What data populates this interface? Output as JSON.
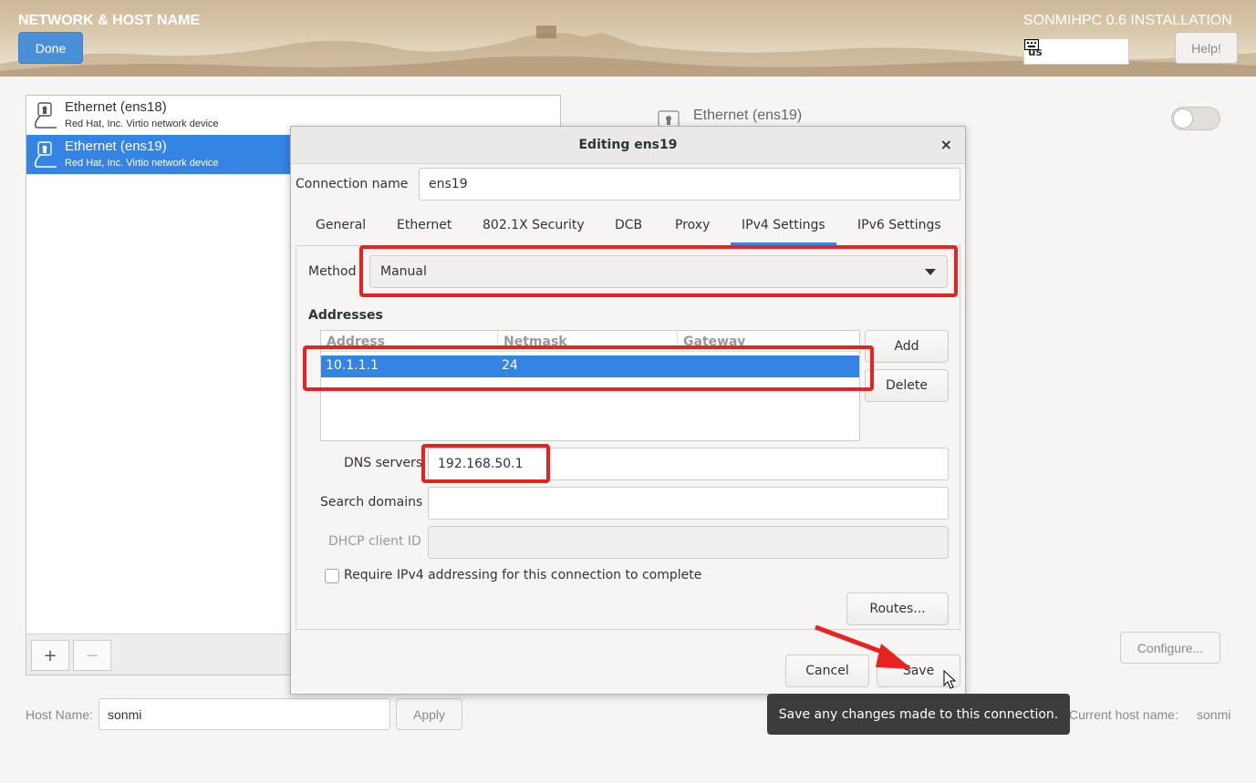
{
  "header": {
    "title": "NETWORK & HOST NAME",
    "product": "SONMIHPC 0.6 INSTALLATION",
    "done_label": "Done",
    "keyboard_layout": "us",
    "help_label": "Help!"
  },
  "devices": [
    {
      "name": "Ethernet (ens18)",
      "description": "Red Hat, Inc. Virtio network device",
      "selected": false
    },
    {
      "name": "Ethernet (ens19)",
      "description": "Red Hat, Inc. Virtio network device",
      "selected": true
    }
  ],
  "list_toolbar": {
    "add": "+",
    "remove": "−"
  },
  "detail": {
    "device_name": "Ethernet (ens19)",
    "configure_label": "Configure..."
  },
  "hostname": {
    "label": "Host Name:",
    "value": "sonmi",
    "apply_label": "Apply",
    "current_label": "Current host name:",
    "current_value": "sonmi"
  },
  "dialog": {
    "title": "Editing ens19",
    "close": "×",
    "connection_name_label": "Connection name",
    "connection_name_value": "ens19",
    "tabs": [
      {
        "label": "General"
      },
      {
        "label": "Ethernet"
      },
      {
        "label": "802.1X Security"
      },
      {
        "label": "DCB"
      },
      {
        "label": "Proxy"
      },
      {
        "label": "IPv4 Settings",
        "active": true
      },
      {
        "label": "IPv6 Settings"
      }
    ],
    "method_label": "Method",
    "method_value": "Manual",
    "addresses_label": "Addresses",
    "address_columns": [
      "Address",
      "Netmask",
      "Gateway"
    ],
    "address_rows": [
      {
        "address": "10.1.1.1",
        "netmask": "24",
        "gateway": ""
      }
    ],
    "add_label": "Add",
    "delete_label": "Delete",
    "dns_label": "DNS servers",
    "dns_value": "192.168.50.1",
    "search_domains_label": "Search domains",
    "search_domains_value": "",
    "dhcp_client_id_label": "DHCP client ID",
    "dhcp_client_id_value": "",
    "require_ipv4_label": "Require IPv4 addressing for this connection to complete",
    "require_ipv4_checked": false,
    "routes_label": "Routes...",
    "cancel_label": "Cancel",
    "save_label": "Save"
  },
  "tooltip": {
    "text": "Save any changes made to this connection."
  },
  "colors": {
    "accent": "#3584e4",
    "annotation": "#e8221f"
  }
}
